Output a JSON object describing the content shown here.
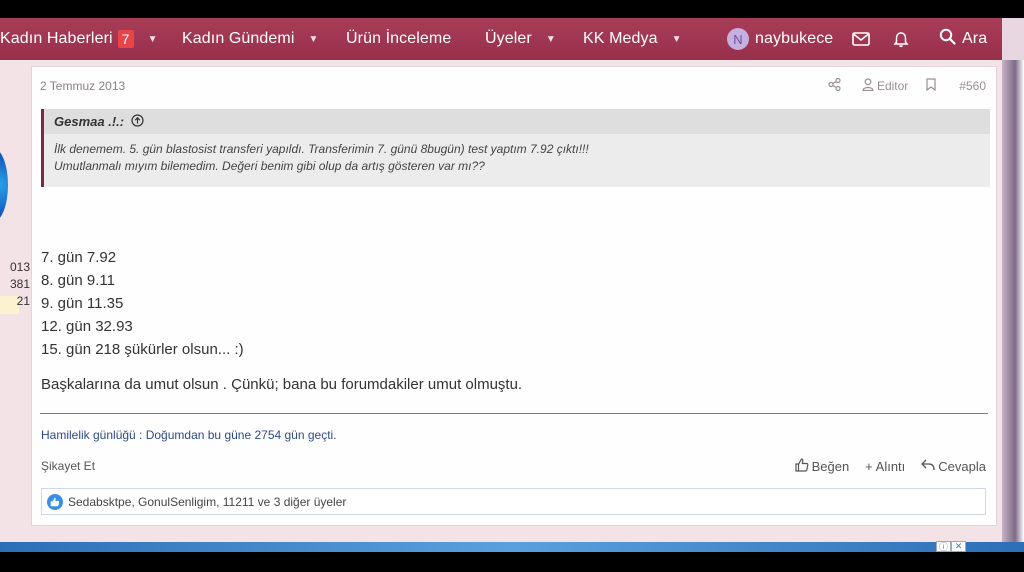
{
  "nav": {
    "items": [
      {
        "label": "Kadın Haberleri",
        "badge": "7"
      },
      {
        "label": "Kadın Gündemi"
      },
      {
        "label": "Ürün İnceleme"
      },
      {
        "label": "Üyeler"
      },
      {
        "label": "KK Medya"
      }
    ],
    "user_initial": "N",
    "username": "naybukece",
    "search_label": "Ara"
  },
  "sidebar": {
    "stats": [
      "013",
      "381",
      "21"
    ]
  },
  "post": {
    "date": "2 Temmuz 2013",
    "editor_label": "Editor",
    "post_number": "#560",
    "quote": {
      "author": "Gesmaa .!.:",
      "lines": [
        "İlk denemem. 5. gün blastosist transferi yapıldı. Transferimin 7. günü 8bugün) test yaptım 7.92 çıktı!!!",
        "Umutlanmalı mıyım bilemedim. Değeri benim gibi olup da artış gösteren var mı??"
      ]
    },
    "content_lines": [
      "7. gün 7.92",
      "8. gün 9.11",
      "9. gün 11.35",
      "12. gün 32.93",
      "15. gün 218 şükürler olsun... :)"
    ],
    "closing_line": "Başkalarına da umut olsun . Çünkü; bana bu forumdakiler umut olmuştu.",
    "signature": "Hamilelik günlüğü : Doğumdan bu güne 2754 gün geçti.",
    "report_label": "Şikayet Et",
    "like_label": "Beğen",
    "quote_label": "+ Alıntı",
    "reply_label": "Cevapla",
    "reactions_text": "Sedabsktpe, GonulSenligim, 11211 ve 3 diğer üyeler"
  },
  "colors": {
    "nav_bg": "#a13652",
    "badge": "#e8454b",
    "quote_border": "#7b2a3f",
    "signature_link": "#2f4a8a",
    "like_blue": "#3b8ee6"
  }
}
